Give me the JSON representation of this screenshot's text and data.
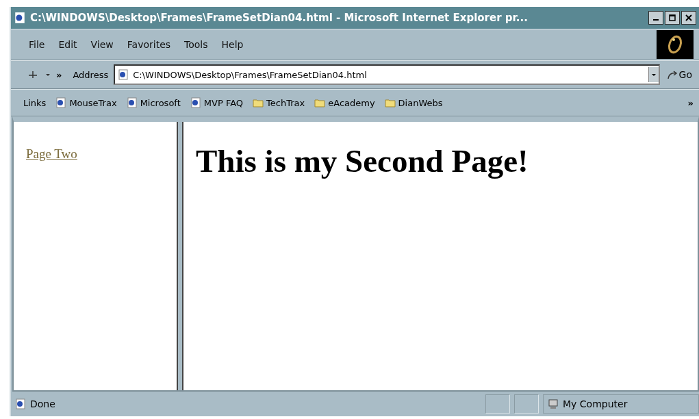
{
  "window": {
    "title": "C:\\WINDOWS\\Desktop\\Frames\\FrameSetDian04.html - Microsoft Internet Explorer pr..."
  },
  "menu": [
    "File",
    "Edit",
    "View",
    "Favorites",
    "Tools",
    "Help"
  ],
  "toolbar": {
    "chevron": "»",
    "address_label": "Address",
    "address": "C:\\WINDOWS\\Desktop\\Frames\\FrameSetDian04.html",
    "go": "Go"
  },
  "links": {
    "label": "Links",
    "chevron": "»",
    "items": [
      {
        "label": "MouseTrax",
        "kind": "page"
      },
      {
        "label": "Microsoft",
        "kind": "page"
      },
      {
        "label": "MVP FAQ",
        "kind": "page"
      },
      {
        "label": "TechTrax",
        "kind": "folder"
      },
      {
        "label": "eAcademy",
        "kind": "folder"
      },
      {
        "label": "DianWebs",
        "kind": "folder"
      }
    ]
  },
  "left_frame": {
    "link": "Page Two"
  },
  "right_frame": {
    "heading": "This is my Second Page!"
  },
  "status_bar": {
    "text": "Done",
    "zone": "My Computer"
  }
}
